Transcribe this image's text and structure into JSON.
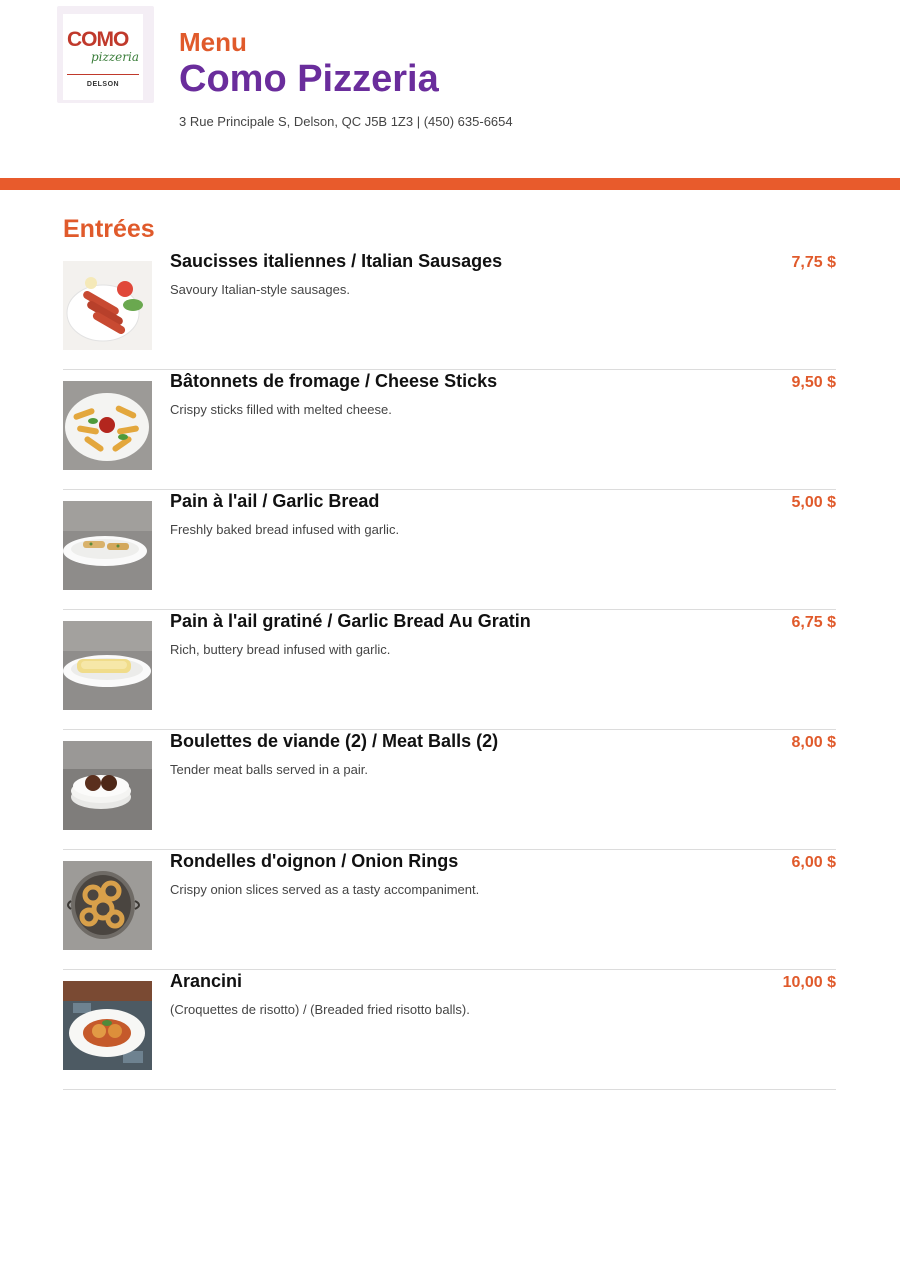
{
  "logo": {
    "brand": "COMO",
    "script": "pizzeria",
    "location": "DELSON"
  },
  "header": {
    "label": "Menu",
    "name": "Como Pizzeria",
    "address": "3 Rue Principale S, Delson, QC J5B 1Z3 | (450) 635-6654"
  },
  "colors": {
    "accent": "#e05a2b",
    "brand": "#6a2d9c",
    "bar": "#e85b2c"
  },
  "section": {
    "title": "Entrées",
    "items": [
      {
        "title": "Saucisses italiennes / Italian Sausages",
        "desc": "Savoury Italian-style sausages.",
        "price": "7,75 $",
        "image": "sausages-photo"
      },
      {
        "title": "Bâtonnets de fromage / Cheese Sticks",
        "desc": "Crispy sticks filled with melted cheese.",
        "price": "9,50 $",
        "image": "cheese-sticks-photo"
      },
      {
        "title": "Pain à l'ail / Garlic Bread",
        "desc": "Freshly baked bread infused with garlic.",
        "price": "5,00 $",
        "image": "garlic-bread-photo"
      },
      {
        "title": "Pain à l'ail gratiné / Garlic Bread Au Gratin",
        "desc": "Rich, buttery bread infused with garlic.",
        "price": "6,75 $",
        "image": "garlic-bread-gratin-photo"
      },
      {
        "title": "Boulettes de viande (2) / Meat Balls (2)",
        "desc": "Tender meat balls served in a pair.",
        "price": "8,00 $",
        "image": "meat-balls-photo"
      },
      {
        "title": "Rondelles d'oignon / Onion Rings",
        "desc": "Crispy onion slices served as a tasty accompaniment.",
        "price": "6,00 $",
        "image": "onion-rings-photo"
      },
      {
        "title": "Arancini",
        "desc": "(Croquettes de risotto) / (Breaded fried risotto balls).",
        "price": "10,00 $",
        "image": "arancini-photo"
      }
    ]
  }
}
